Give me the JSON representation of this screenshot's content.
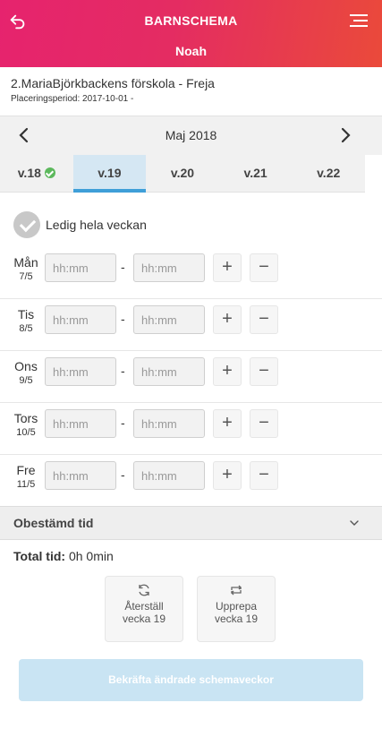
{
  "header": {
    "title": "BARNSCHEMA",
    "child_name": "Noah",
    "back_icon": "back-arrow-icon",
    "menu_icon": "hamburger-menu-icon",
    "gradient_colors": [
      "#e6236e",
      "#ea4a3a"
    ]
  },
  "placement": {
    "school": "2.MariaBjörkbackens förskola - Freja",
    "period": "Placeringsperiod: 2017-10-01 -"
  },
  "month_nav": {
    "label": "Maj 2018",
    "prev_icon": "chevron-left-icon",
    "next_icon": "chevron-right-icon"
  },
  "weeks": [
    {
      "label": "v.18",
      "confirmed": true
    },
    {
      "label": "v.19",
      "active": true
    },
    {
      "label": "v.20"
    },
    {
      "label": "v.21"
    },
    {
      "label": "v.22"
    }
  ],
  "free_week_label": "Ledig hela veckan",
  "days": [
    {
      "name": "Mån",
      "date": "7/5"
    },
    {
      "name": "Tis",
      "date": "8/5"
    },
    {
      "name": "Ons",
      "date": "9/5"
    },
    {
      "name": "Tors",
      "date": "10/5"
    },
    {
      "name": "Fre",
      "date": "11/5"
    }
  ],
  "time_placeholder": "hh:mm",
  "dash": "-",
  "plus": "+",
  "minus": "−",
  "undetermined_label": "Obestämd tid",
  "total": {
    "label": "Total tid:",
    "value": "0h 0min"
  },
  "actions": {
    "reset": {
      "line1": "Återställ",
      "line2": "vecka 19",
      "icon": "refresh-icon"
    },
    "repeat": {
      "line1": "Upprepa",
      "line2": "vecka 19",
      "icon": "repeat-icon"
    }
  },
  "confirm_label": "Bekräfta ändrade schemaveckor",
  "colors": {
    "accent": "#3f9fd8",
    "active_tab_bg": "#d5e7f3",
    "confirm_bg": "#c9e4f3",
    "check_green": "#5cb85c"
  }
}
